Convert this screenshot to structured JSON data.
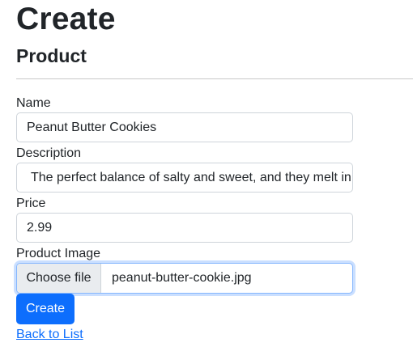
{
  "page": {
    "title": "Create",
    "subtitle": "Product"
  },
  "form": {
    "name": {
      "label": "Name",
      "value": "Peanut Butter Cookies"
    },
    "description": {
      "label": "Description",
      "value": "The perfect balance of salty and sweet, and they melt in"
    },
    "price": {
      "label": "Price",
      "value": "2.99"
    },
    "image": {
      "label": "Product Image",
      "button_label": "Choose file",
      "file_name": "peanut-butter-cookie.jpg"
    },
    "submit_label": "Create"
  },
  "links": {
    "back_label": "Back to List"
  },
  "colors": {
    "primary": "#0d6efd",
    "focus_border": "#86b7fe",
    "file_button_bg": "#e9ecef"
  }
}
